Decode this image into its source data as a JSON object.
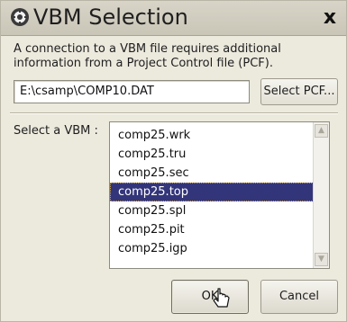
{
  "dialog": {
    "title": "VBM Selection",
    "title_icon": "gear-icon",
    "close_label": "x"
  },
  "description": "A connection to a VBM file requires additional information from a Project Control file (PCF).",
  "pcf": {
    "value": "E:\\csamp\\COMP10.DAT",
    "button_label": "Select PCF..."
  },
  "vbm": {
    "label": "Select a VBM :",
    "items": [
      {
        "label": "comp25.wrk"
      },
      {
        "label": "comp25.tru"
      },
      {
        "label": "comp25.sec"
      },
      {
        "label": "comp25.top"
      },
      {
        "label": "comp25.spl"
      },
      {
        "label": "comp25.pit"
      },
      {
        "label": "comp25.igp"
      }
    ],
    "selected": "comp25.top"
  },
  "buttons": {
    "ok_label": "OK",
    "cancel_label": "Cancel"
  },
  "colors": {
    "selection": "#33357a",
    "dialog_bg": "#ece9dd"
  }
}
